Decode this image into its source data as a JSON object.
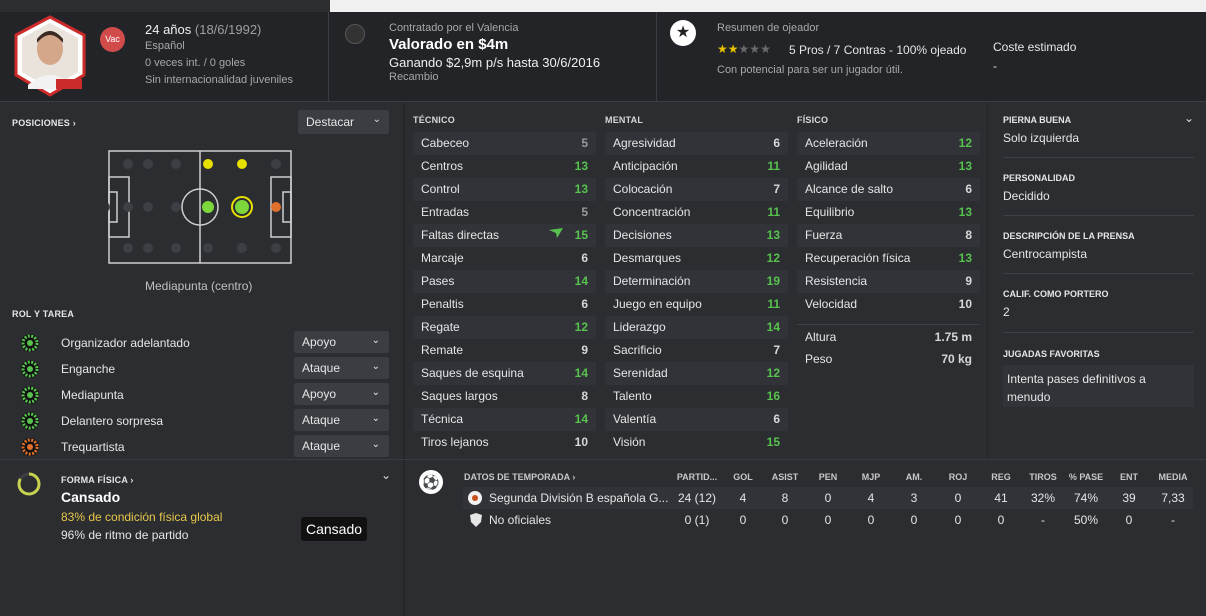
{
  "header": {
    "age_label": "24 años",
    "dob": "(18/6/1992)",
    "nationality": "Español",
    "caps": "0 veces int. / 0 goles",
    "youth": "Sin internacionalidad juveniles",
    "badge_vac": "Vac",
    "club_line": "Contratado por el Valencia",
    "value": "Valorado en $4m",
    "wage": "Ganando $2,9m p/s hasta 30/6/2016",
    "squad_status": "Recambio",
    "scout_title": "Resumen de ojeador",
    "scout_stars_on": 2,
    "scout_stars_total": 5,
    "scout_summary": "5 Pros / 7 Contras - 100% ojeado",
    "scout_note": "Con potencial para ser un jugador útil.",
    "cost_label": "Coste estimado",
    "cost_value": "-"
  },
  "positions": {
    "title": "POSICIONES",
    "dropdown": "Destacar",
    "position_label": "Mediapunta (centro)"
  },
  "roles": {
    "title": "ROL Y TAREA",
    "items": [
      {
        "name": "Organizador adelantado",
        "duty": "Apoyo",
        "color": "#58c24e"
      },
      {
        "name": "Enganche",
        "duty": "Ataque",
        "color": "#58c24e"
      },
      {
        "name": "Mediapunta",
        "duty": "Apoyo",
        "color": "#58c24e"
      },
      {
        "name": "Delantero sorpresa",
        "duty": "Ataque",
        "color": "#58c24e"
      },
      {
        "name": "Trequartista",
        "duty": "Ataque",
        "color": "#e0702b"
      }
    ]
  },
  "attributes": {
    "technical_title": "TÉCNICO",
    "mental_title": "MENTAL",
    "physical_title": "FÍSICO",
    "technical": [
      {
        "n": "Cabeceo",
        "v": "5",
        "c": "gr"
      },
      {
        "n": "Centros",
        "v": "13",
        "c": "g"
      },
      {
        "n": "Control",
        "v": "13",
        "c": "g"
      },
      {
        "n": "Entradas",
        "v": "5",
        "c": "gr"
      },
      {
        "n": "Faltas directas",
        "v": "15",
        "c": "g"
      },
      {
        "n": "Marcaje",
        "v": "6",
        "c": "w"
      },
      {
        "n": "Pases",
        "v": "14",
        "c": "g"
      },
      {
        "n": "Penaltis",
        "v": "6",
        "c": "w"
      },
      {
        "n": "Regate",
        "v": "12",
        "c": "g"
      },
      {
        "n": "Remate",
        "v": "9",
        "c": "w"
      },
      {
        "n": "Saques de esquina",
        "v": "14",
        "c": "g"
      },
      {
        "n": "Saques largos",
        "v": "8",
        "c": "w"
      },
      {
        "n": "Técnica",
        "v": "14",
        "c": "g"
      },
      {
        "n": "Tiros lejanos",
        "v": "10",
        "c": "w"
      }
    ],
    "mental": [
      {
        "n": "Agresividad",
        "v": "6",
        "c": "w"
      },
      {
        "n": "Anticipación",
        "v": "11",
        "c": "g"
      },
      {
        "n": "Colocación",
        "v": "7",
        "c": "w"
      },
      {
        "n": "Concentración",
        "v": "11",
        "c": "g"
      },
      {
        "n": "Decisiones",
        "v": "13",
        "c": "g"
      },
      {
        "n": "Desmarques",
        "v": "12",
        "c": "g"
      },
      {
        "n": "Determinación",
        "v": "19",
        "c": "g"
      },
      {
        "n": "Juego en equipo",
        "v": "11",
        "c": "g"
      },
      {
        "n": "Liderazgo",
        "v": "14",
        "c": "g"
      },
      {
        "n": "Sacrificio",
        "v": "7",
        "c": "w"
      },
      {
        "n": "Serenidad",
        "v": "12",
        "c": "g"
      },
      {
        "n": "Talento",
        "v": "16",
        "c": "g"
      },
      {
        "n": "Valentía",
        "v": "6",
        "c": "w"
      },
      {
        "n": "Visión",
        "v": "15",
        "c": "g"
      }
    ],
    "physical": [
      {
        "n": "Aceleración",
        "v": "12",
        "c": "g"
      },
      {
        "n": "Agilidad",
        "v": "13",
        "c": "g"
      },
      {
        "n": "Alcance de salto",
        "v": "6",
        "c": "w"
      },
      {
        "n": "Equilibrio",
        "v": "13",
        "c": "g"
      },
      {
        "n": "Fuerza",
        "v": "8",
        "c": "w"
      },
      {
        "n": "Recuperación física",
        "v": "13",
        "c": "g"
      },
      {
        "n": "Resistencia",
        "v": "9",
        "c": "w"
      },
      {
        "n": "Velocidad",
        "v": "10",
        "c": "w"
      }
    ],
    "height_label": "Altura",
    "height_value": "1.75 m",
    "weight_label": "Peso",
    "weight_value": "70 kg"
  },
  "info": {
    "foot_title": "PIERNA BUENA",
    "foot_value": "Solo izquierda",
    "personality_title": "PERSONALIDAD",
    "personality_value": "Decidido",
    "press_title": "DESCRIPCIÓN DE LA PRENSA",
    "press_value": "Centrocampista",
    "gk_title": "CALIF. COMO PORTERO",
    "gk_value": "2",
    "moves_title": "JUGADAS FAVORITAS",
    "moves_value": "Intenta pases definitivos a menudo"
  },
  "fitness": {
    "title": "FORMA FÍSICA",
    "status": "Cansado",
    "condition": "83% de condición física global",
    "sharpness": "96% de ritmo de partido",
    "tooltip": "Cansado",
    "condition_pct": 83
  },
  "season": {
    "title": "DATOS DE TEMPORADA",
    "columns": [
      "PARTID...",
      "GOL",
      "ASIST",
      "PEN",
      "MJP",
      "AM.",
      "ROJ",
      "REG",
      "TIROS",
      "% PASE",
      "ENT",
      "MEDIA"
    ],
    "rows": [
      {
        "comp": "Segunda División B española G...",
        "vals": [
          "24 (12)",
          "4",
          "8",
          "0",
          "4",
          "3",
          "0",
          "41",
          "32%",
          "74%",
          "39",
          "7,33"
        ]
      },
      {
        "comp": "No oficiales",
        "vals": [
          "0 (1)",
          "0",
          "0",
          "0",
          "0",
          "0",
          "0",
          "0",
          "-",
          "50%",
          "0",
          "-"
        ]
      }
    ]
  }
}
